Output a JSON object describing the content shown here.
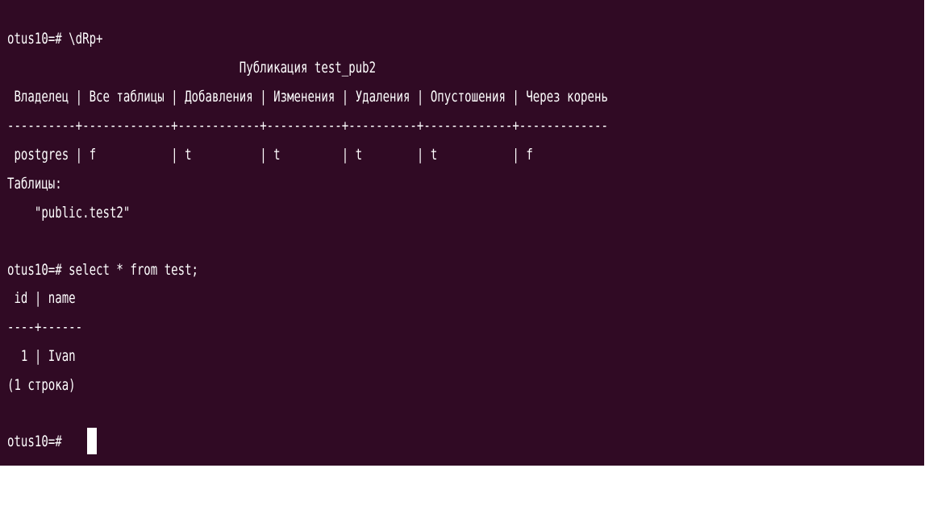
{
  "terminal": {
    "lines": [
      "",
      "otus10=# \\dRp+",
      "                                  Публикация test_pub2",
      " Владелец | Все таблицы | Добавления | Изменения | Удаления | Опустошения | Через корень",
      "----------+-------------+------------+-----------+----------+-------------+-------------",
      " postgres | f           | t          | t         | t        | t           | f",
      "Таблицы:",
      "    \"public.test2\"",
      "",
      "otus10=# select * from test;",
      " id | name",
      "----+------",
      "  1 | Ivan",
      "(1 строка)",
      "",
      "otus10=# "
    ]
  },
  "colors": {
    "terminal_background": "#300a24",
    "terminal_text": "#ffffff",
    "page_background": "#ffffff"
  }
}
